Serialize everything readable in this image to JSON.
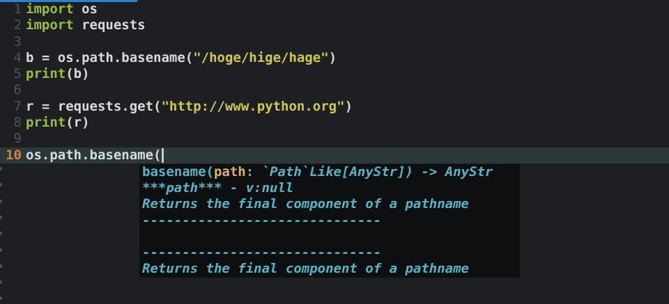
{
  "editor": {
    "background": "#1d1f22",
    "top_bar_color": "#2b82d4",
    "current_line_background": "#2b3837",
    "colors": {
      "keyword": "#97c13d",
      "string": "#cfc852",
      "plain": "#d8dbd9",
      "line_number": "#4e5559",
      "active_line_number": "#d0853c",
      "cursor": "#c7cbcb"
    },
    "lines": [
      {
        "number": "1",
        "active": false,
        "cursor": false,
        "tokens": [
          {
            "type": "keyword",
            "text": "import"
          },
          {
            "type": "plain",
            "text": " os"
          }
        ]
      },
      {
        "number": "2",
        "active": false,
        "cursor": false,
        "tokens": [
          {
            "type": "keyword",
            "text": "import"
          },
          {
            "type": "plain",
            "text": " requests"
          }
        ]
      },
      {
        "number": "3",
        "active": false,
        "cursor": false,
        "tokens": []
      },
      {
        "number": "4",
        "active": false,
        "cursor": false,
        "tokens": [
          {
            "type": "plain",
            "text": "b = os.path.basename("
          },
          {
            "type": "string",
            "text": "\"/hoge/hige/hage\""
          },
          {
            "type": "plain",
            "text": ")"
          }
        ]
      },
      {
        "number": "5",
        "active": false,
        "cursor": false,
        "tokens": [
          {
            "type": "keyword",
            "text": "print"
          },
          {
            "type": "plain",
            "text": "(b)"
          }
        ]
      },
      {
        "number": "6",
        "active": false,
        "cursor": false,
        "tokens": []
      },
      {
        "number": "7",
        "active": false,
        "cursor": false,
        "tokens": [
          {
            "type": "plain",
            "text": "r = requests.get("
          },
          {
            "type": "string",
            "text": "\"http://www.python.org\""
          },
          {
            "type": "plain",
            "text": ")"
          }
        ]
      },
      {
        "number": "8",
        "active": false,
        "cursor": false,
        "tokens": [
          {
            "type": "keyword",
            "text": "print"
          },
          {
            "type": "plain",
            "text": "(r)"
          }
        ]
      },
      {
        "number": "9",
        "active": false,
        "cursor": false,
        "tokens": []
      },
      {
        "number": "10",
        "active": true,
        "cursor": true,
        "tokens": [
          {
            "type": "plain",
            "text": "os.path.basename("
          }
        ]
      }
    ],
    "empty_line_marker_count": 9
  },
  "hover_popup": {
    "background": "#0d0f10",
    "text_color": "#56b5c4",
    "param_color": "#d8b266",
    "lines": [
      {
        "segments": [
          {
            "style": "signature",
            "text": "basename("
          },
          {
            "style": "param",
            "text": "path"
          },
          {
            "style": "signature",
            "text": ": "
          },
          {
            "style": "italic",
            "text": "`Path`Like[AnyStr]) -> AnyStr"
          }
        ]
      },
      {
        "segments": [
          {
            "style": "italic",
            "text": "***path*** - v:null"
          }
        ]
      },
      {
        "segments": [
          {
            "style": "italic",
            "text": "Returns the final component of a pathname"
          }
        ]
      },
      {
        "segments": [
          {
            "style": "italic",
            "text": "------------------------------"
          }
        ]
      },
      {
        "segments": []
      },
      {
        "segments": [
          {
            "style": "italic",
            "text": "------------------------------"
          }
        ]
      },
      {
        "segments": [
          {
            "style": "italic",
            "text": "Returns the final component of a pathname"
          }
        ]
      }
    ]
  }
}
